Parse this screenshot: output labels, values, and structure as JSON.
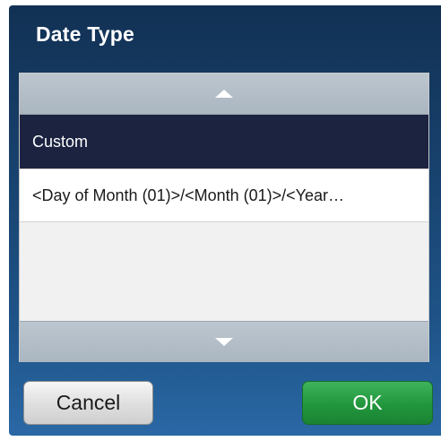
{
  "dialog": {
    "title": "Date Type"
  },
  "list": {
    "items": [
      {
        "label": "Custom",
        "selected": true
      },
      {
        "label": "<Day of Month (01)>/<Month (01)>/<Year…",
        "selected": false
      }
    ],
    "scroll_up_icon": "triangle-up-icon",
    "scroll_down_icon": "triangle-down-icon"
  },
  "buttons": {
    "cancel_label": "Cancel",
    "ok_label": "OK"
  },
  "colors": {
    "dialog_background": "#17406b",
    "selected_row": "#1b2341",
    "ok_button": "#22963d"
  }
}
